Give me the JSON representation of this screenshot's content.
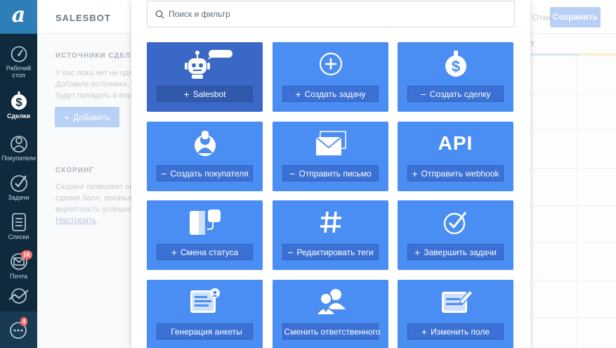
{
  "sidebar": {
    "logo": "a",
    "items": [
      {
        "label": "Рабочий\nстол",
        "icon": "speedometer-icon"
      },
      {
        "label": "Сделки",
        "icon": "dollar-icon"
      },
      {
        "label": "Покупатели",
        "icon": "customers-icon"
      },
      {
        "label": "Задачи",
        "icon": "tasks-check-icon"
      },
      {
        "label": "Списки",
        "icon": "lists-icon"
      },
      {
        "label": "Почта",
        "icon": "mail-icon",
        "badge": "1K"
      },
      {
        "label": "",
        "icon": "analytics-icon"
      }
    ],
    "chat_badge": "4"
  },
  "background": {
    "title": "SALESBOT",
    "cancel": "Отмена",
    "save": "Сохранить",
    "sources_title": "ИСТОЧНИКИ СДЕЛОК",
    "sources_lines": [
      "У вас пока нет ни одного источника.",
      "Добавьте источники, чтобы",
      "будут попадать в воронку."
    ],
    "add_button": "Добавить",
    "scoring_title": "СКОРИНГ",
    "scoring_lines": [
      "Скоринг позволяет оценить",
      "сделке балл, показывающий",
      "вероятность успешной сделки."
    ],
    "configure_link": "Настроить",
    "column_head": "Т"
  },
  "modal": {
    "search_placeholder": "Поиск и фильтр",
    "tiles": [
      {
        "label": "Salesbot",
        "prefix": "+",
        "icon": "robot-icon",
        "name": "salesbot"
      },
      {
        "label": "Создать задачу",
        "prefix": "+",
        "icon": "plus-circle-icon",
        "name": "create-task"
      },
      {
        "label": "Создать сделку",
        "prefix": "−",
        "icon": "dollar-icon",
        "name": "create-deal"
      },
      {
        "label": "Создать покупателя",
        "prefix": "−",
        "icon": "customer-icon",
        "name": "create-customer"
      },
      {
        "label": "Отправить письмо",
        "prefix": "−",
        "icon": "envelope-icon",
        "name": "send-email"
      },
      {
        "label": "Отправить webhook",
        "prefix": "+",
        "icon": "api-icon",
        "icon_text": "API",
        "name": "send-webhook"
      },
      {
        "label": "Смена статуса",
        "prefix": "+",
        "icon": "status-change-icon",
        "name": "change-status"
      },
      {
        "label": "Редактировать теги",
        "prefix": "−",
        "icon": "hashtag-icon",
        "name": "edit-tags"
      },
      {
        "label": "Завершить задачи",
        "prefix": "+",
        "icon": "check-circle-icon",
        "name": "complete-tasks"
      },
      {
        "label": "Генерация анкеты",
        "prefix": "",
        "icon": "form-icon",
        "name": "generate-form"
      },
      {
        "label": "Сменить ответственного",
        "prefix": "",
        "icon": "users-swap-icon",
        "name": "change-responsible"
      },
      {
        "label": "Изменить поле",
        "prefix": "+",
        "icon": "edit-field-icon",
        "name": "edit-field"
      }
    ]
  },
  "colors": {
    "sidebar": "#0f2a3d",
    "logo": "#2e7fb8",
    "tile": "#4a8df3",
    "tile_active": "#3b68c6",
    "tile_button": "#3b70d4",
    "badge": "#f36b6b"
  }
}
